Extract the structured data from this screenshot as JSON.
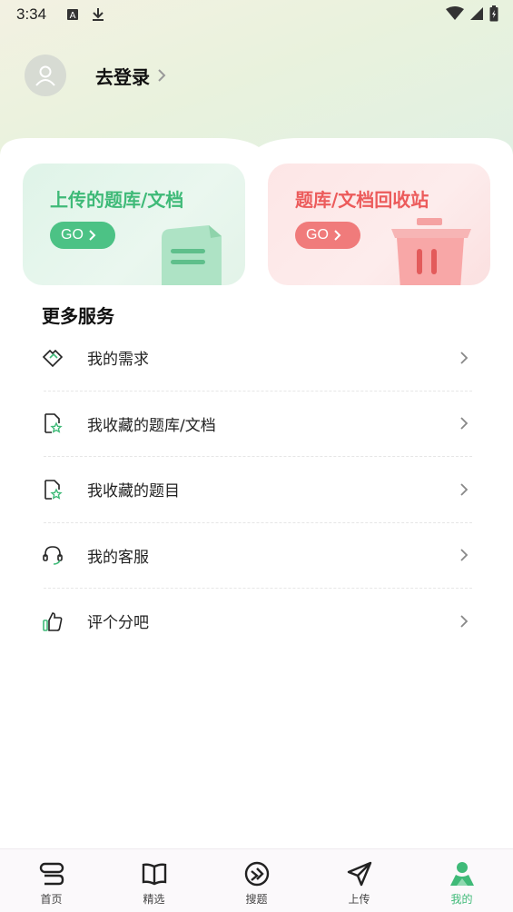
{
  "status_bar": {
    "time": "3:34",
    "icons": [
      "font-icon",
      "download-icon",
      "wifi-icon",
      "signal-icon",
      "battery-icon"
    ]
  },
  "header": {
    "login_label": "去登录"
  },
  "cards": [
    {
      "title": "上传的题库/文档",
      "button": "GO",
      "color": "#3fba78"
    },
    {
      "title": "题库/文档回收站",
      "button": "GO",
      "color": "#ec5b5b"
    }
  ],
  "section": {
    "title": "更多服务"
  },
  "menu": [
    {
      "label": "我的需求",
      "icon": "handshake-icon"
    },
    {
      "label": "我收藏的题库/文档",
      "icon": "doc-star-icon"
    },
    {
      "label": "我收藏的题目",
      "icon": "doc-star-icon"
    },
    {
      "label": "我的客服",
      "icon": "headset-icon"
    },
    {
      "label": "评个分吧",
      "icon": "thumbs-up-icon"
    }
  ],
  "tabbar": [
    {
      "label": "首页",
      "icon": "home-icon",
      "active": false
    },
    {
      "label": "精选",
      "icon": "book-icon",
      "active": false
    },
    {
      "label": "搜题",
      "icon": "search-circle-icon",
      "active": false
    },
    {
      "label": "上传",
      "icon": "send-icon",
      "active": false
    },
    {
      "label": "我的",
      "icon": "person-icon",
      "active": true
    }
  ],
  "colors": {
    "accent": "#3fba78",
    "danger": "#ec5b5b"
  }
}
